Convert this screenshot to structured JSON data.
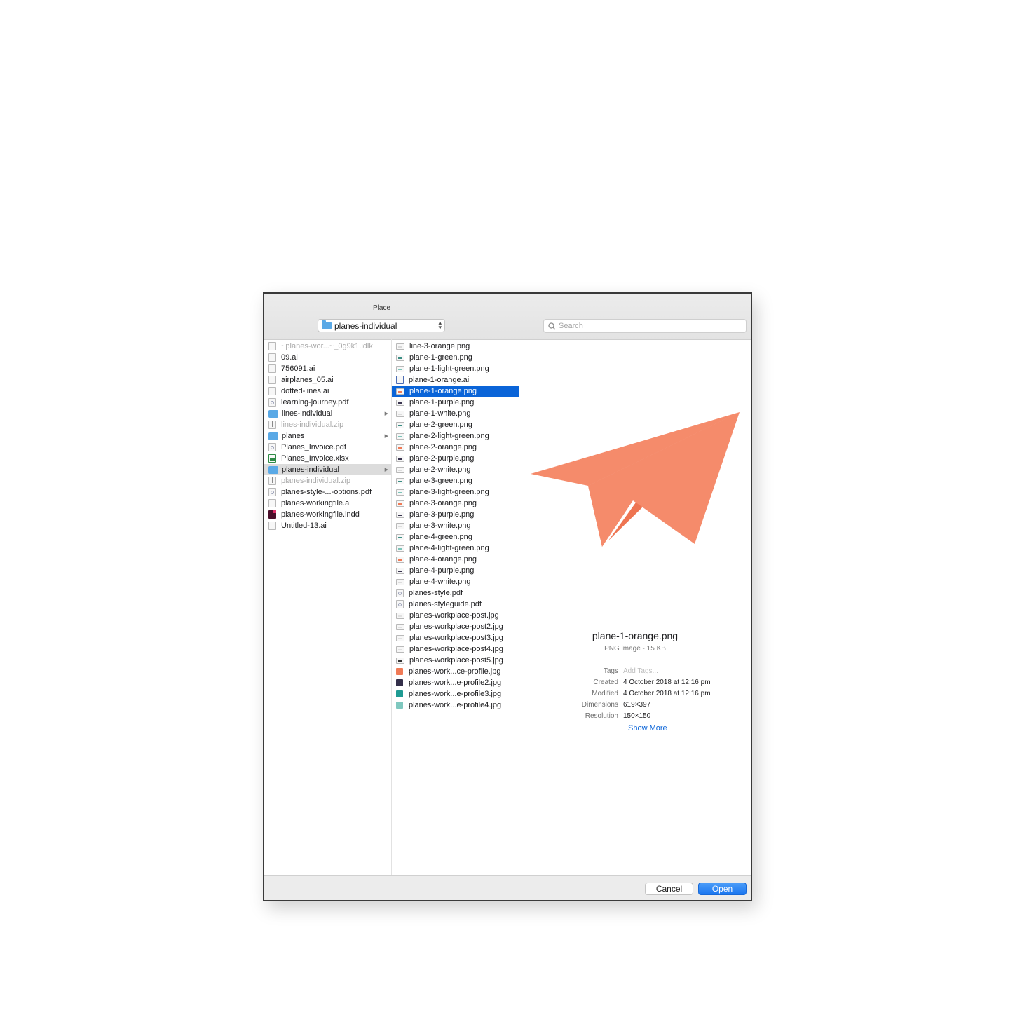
{
  "dialog": {
    "title": "Place",
    "location_popup": "planes-individual",
    "search_placeholder": "Search"
  },
  "column1": {
    "items": [
      {
        "label": "~planes-wor...~_0g9k1.idlk",
        "icon": "generic-file-icon",
        "dim": true
      },
      {
        "label": "09.ai",
        "icon": "ai-file-icon"
      },
      {
        "label": "756091.ai",
        "icon": "ai-file-icon"
      },
      {
        "label": "airplanes_05.ai",
        "icon": "ai-file-icon"
      },
      {
        "label": "dotted-lines.ai",
        "icon": "ai-file-icon"
      },
      {
        "label": "learning-journey.pdf",
        "icon": "pdf-file-icon"
      },
      {
        "label": "lines-individual",
        "icon": "folder-icon",
        "folder": true
      },
      {
        "label": "lines-individual.zip",
        "icon": "zip-file-icon",
        "dim": true
      },
      {
        "label": "planes",
        "icon": "folder-icon",
        "folder": true
      },
      {
        "label": "Planes_Invoice.pdf",
        "icon": "pdf-file-icon"
      },
      {
        "label": "Planes_Invoice.xlsx",
        "icon": "xlsx-file-icon"
      },
      {
        "label": "planes-individual",
        "icon": "folder-icon",
        "folder": true,
        "selected": true
      },
      {
        "label": "planes-individual.zip",
        "icon": "zip-file-icon",
        "dim": true
      },
      {
        "label": "planes-style-...-options.pdf",
        "icon": "pdf-file-icon"
      },
      {
        "label": "planes-workingfile.ai",
        "icon": "ai-file-icon"
      },
      {
        "label": "planes-workingfile.indd",
        "icon": "indd-file-icon"
      },
      {
        "label": "Untitled-13.ai",
        "icon": "ai-file-icon"
      }
    ]
  },
  "column2": {
    "items": [
      {
        "label": "line-3-orange.png",
        "icon": "png-file-icon",
        "color": "#d9d9d9"
      },
      {
        "label": "plane-1-green.png",
        "icon": "png-file-icon",
        "color": "#3a8e84"
      },
      {
        "label": "plane-1-light-green.png",
        "icon": "png-file-icon",
        "color": "#7bc4b9"
      },
      {
        "label": "plane-1-orange.ai",
        "icon": "ai-file-icon",
        "color": "#4d6db5"
      },
      {
        "label": "plane-1-orange.png",
        "icon": "png-file-icon",
        "color": "#f07a56",
        "selected": true
      },
      {
        "label": "plane-1-purple.png",
        "icon": "png-file-icon",
        "color": "#3a3550"
      },
      {
        "label": "plane-1-white.png",
        "icon": "png-file-icon",
        "color": "#dcdcdc"
      },
      {
        "label": "plane-2-green.png",
        "icon": "png-file-icon",
        "color": "#3a8e84"
      },
      {
        "label": "plane-2-light-green.png",
        "icon": "png-file-icon",
        "color": "#7bc4b9"
      },
      {
        "label": "plane-2-orange.png",
        "icon": "png-file-icon",
        "color": "#f07a56"
      },
      {
        "label": "plane-2-purple.png",
        "icon": "png-file-icon",
        "color": "#3a3550"
      },
      {
        "label": "plane-2-white.png",
        "icon": "png-file-icon",
        "color": "#dcdcdc"
      },
      {
        "label": "plane-3-green.png",
        "icon": "png-file-icon",
        "color": "#3a8e84"
      },
      {
        "label": "plane-3-light-green.png",
        "icon": "png-file-icon",
        "color": "#7bc4b9"
      },
      {
        "label": "plane-3-orange.png",
        "icon": "png-file-icon",
        "color": "#f07a56"
      },
      {
        "label": "plane-3-purple.png",
        "icon": "png-file-icon",
        "color": "#3a3550"
      },
      {
        "label": "plane-3-white.png",
        "icon": "png-file-icon",
        "color": "#dcdcdc"
      },
      {
        "label": "plane-4-green.png",
        "icon": "png-file-icon",
        "color": "#3a8e84"
      },
      {
        "label": "plane-4-light-green.png",
        "icon": "png-file-icon",
        "color": "#7bc4b9"
      },
      {
        "label": "plane-4-orange.png",
        "icon": "png-file-icon",
        "color": "#f07a56"
      },
      {
        "label": "plane-4-purple.png",
        "icon": "png-file-icon",
        "color": "#3a3550"
      },
      {
        "label": "plane-4-white.png",
        "icon": "png-file-icon",
        "color": "#dcdcdc"
      },
      {
        "label": "planes-style.pdf",
        "icon": "pdf-file-icon"
      },
      {
        "label": "planes-styleguide.pdf",
        "icon": "pdf-file-icon"
      },
      {
        "label": "planes-workplace-post.jpg",
        "icon": "jpg-file-icon",
        "color": "#e0e0e0"
      },
      {
        "label": "planes-workplace-post2.jpg",
        "icon": "jpg-file-icon",
        "color": "#e0e0e0"
      },
      {
        "label": "planes-workplace-post3.jpg",
        "icon": "jpg-file-icon",
        "color": "#e0e0e0"
      },
      {
        "label": "planes-workplace-post4.jpg",
        "icon": "jpg-file-icon",
        "color": "#e0e0e0"
      },
      {
        "label": "planes-workplace-post5.jpg",
        "icon": "jpg-file-icon",
        "color": "#333333"
      },
      {
        "label": "planes-work...ce-profile.jpg",
        "icon": "jpg-thumbnail-icon",
        "color": "#f07a56",
        "swatch": true
      },
      {
        "label": "planes-work...e-profile2.jpg",
        "icon": "jpg-thumbnail-icon",
        "color": "#34304a",
        "swatch": true
      },
      {
        "label": "planes-work...e-profile3.jpg",
        "icon": "jpg-thumbnail-icon",
        "color": "#1f9b93",
        "swatch": true
      },
      {
        "label": "planes-work...e-profile4.jpg",
        "icon": "jpg-thumbnail-icon",
        "color": "#7fc8bf",
        "swatch": true
      }
    ]
  },
  "preview": {
    "filename": "plane-1-orange.png",
    "type_size": "PNG image - 15 KB",
    "plane_colors": {
      "light": "#f58b6b",
      "dark": "#ee7552"
    },
    "info": [
      {
        "label": "Tags",
        "value": "Add Tags...",
        "placeholder": true
      },
      {
        "label": "Created",
        "value": "4 October 2018 at 12:16 pm"
      },
      {
        "label": "Modified",
        "value": "4 October 2018 at 12:16 pm"
      },
      {
        "label": "Dimensions",
        "value": "619×397"
      },
      {
        "label": "Resolution",
        "value": "150×150"
      }
    ],
    "show_more": "Show More"
  },
  "buttons": {
    "cancel": "Cancel",
    "open": "Open"
  }
}
